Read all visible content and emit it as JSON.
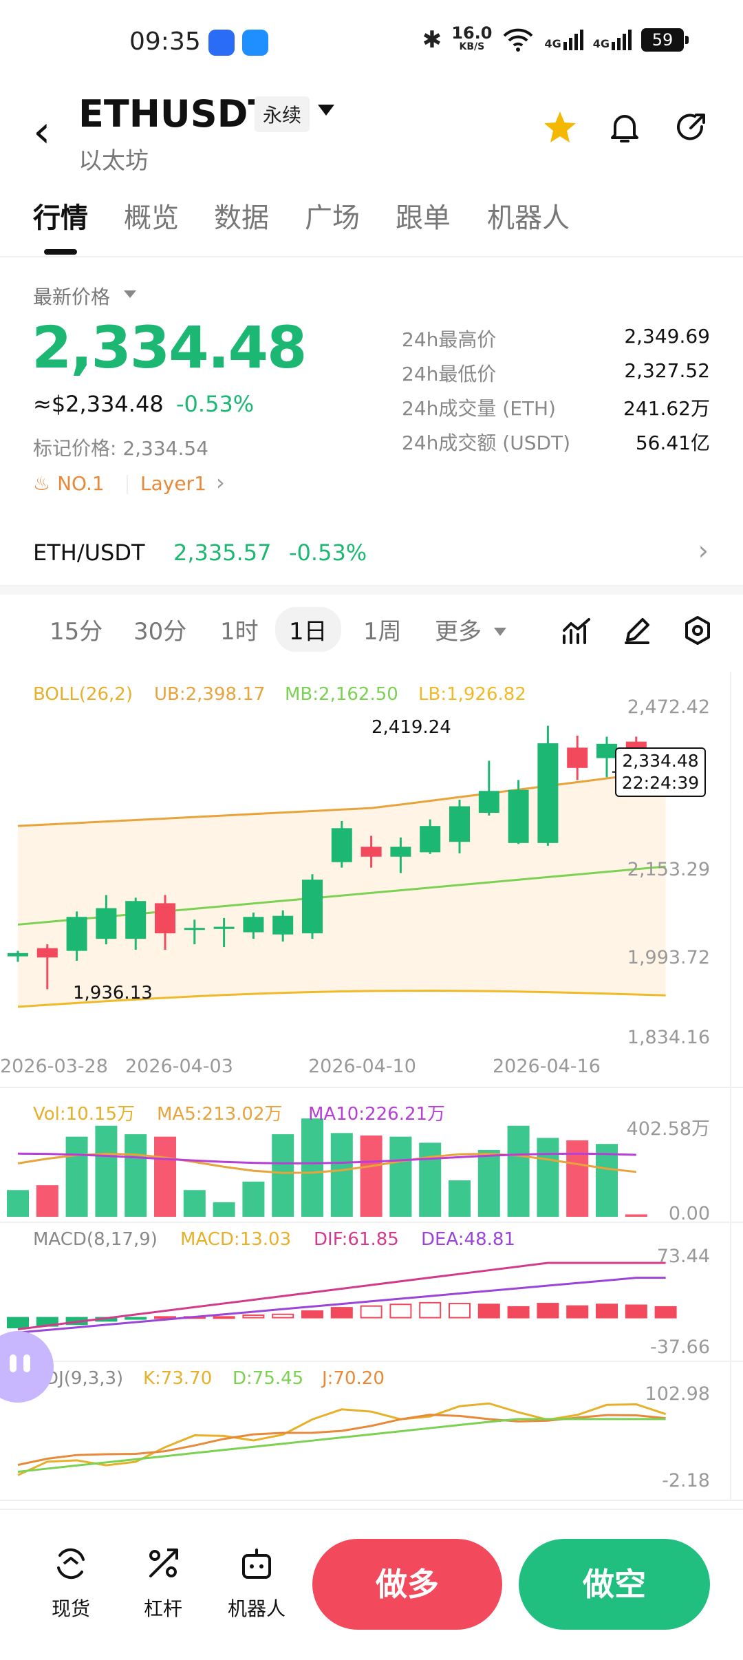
{
  "status_bar": {
    "time": "09:35",
    "net_speed_value": "16.0",
    "net_speed_unit": "KB/S",
    "signal1": "4G",
    "signal2": "4G",
    "battery": "59"
  },
  "header": {
    "symbol": "ETHUSDT",
    "contract_type": "永续",
    "name": "以太坊"
  },
  "tabs": [
    "行情",
    "概览",
    "数据",
    "广场",
    "跟单",
    "机器人"
  ],
  "price": {
    "latest_label": "最新价格",
    "last": "2,334.48",
    "usd": "≈$2,334.48",
    "change": "-0.53%",
    "mark": "标记价格: 2,334.54",
    "badge_rank": "NO.1",
    "badge_sector": "Layer1"
  },
  "stats": [
    {
      "label": "24h最高价",
      "value": "2,349.69"
    },
    {
      "label": "24h最低价",
      "value": "2,327.52"
    },
    {
      "label": "24h成交量 (ETH)",
      "value": "241.62万"
    },
    {
      "label": "24h成交额 (USDT)",
      "value": "56.41亿"
    }
  ],
  "spot_pair": {
    "name": "ETH/USDT",
    "price": "2,335.57",
    "change": "-0.53%"
  },
  "intervals": [
    "15分",
    "30分",
    "1时",
    "1日",
    "1周",
    "更多"
  ],
  "colors": {
    "up": "#1db774",
    "down": "#f2495c",
    "boll_ub": "#e8a33a",
    "boll_mb": "#7ad152",
    "boll_lb": "#f0b928",
    "ma5": "#e8a33a",
    "ma10": "#b83ed8",
    "dif": "#d33a8c",
    "dea": "#9a45d8"
  },
  "chart_data": {
    "type": "candlestick",
    "boll": {
      "label": "BOLL(26,2)",
      "ub": "UB:2,398.17",
      "mb": "MB:2,162.50",
      "lb": "LB:1,926.82"
    },
    "price_axis": [
      "2,472.42",
      "2,153.29",
      "1,993.72",
      "1,834.16"
    ],
    "price_range": [
      1834.16,
      2472.42
    ],
    "x_labels": [
      "2026-03-28",
      "2026-04-03",
      "2026-04-10",
      "2026-04-16"
    ],
    "high_marker": "2,419.24",
    "low_marker": "1,936.13",
    "current_price": "2,334.48",
    "countdown": "22:24:39",
    "candles": [
      {
        "o": 1998,
        "h": 2008,
        "l": 1988,
        "c": 2004
      },
      {
        "o": 2013,
        "h": 2020,
        "l": 1938,
        "c": 1996
      },
      {
        "o": 2008,
        "h": 2080,
        "l": 1990,
        "c": 2070
      },
      {
        "o": 2030,
        "h": 2110,
        "l": 2020,
        "c": 2086
      },
      {
        "o": 2030,
        "h": 2105,
        "l": 2010,
        "c": 2099
      },
      {
        "o": 2095,
        "h": 2110,
        "l": 2010,
        "c": 2040
      },
      {
        "o": 2050,
        "h": 2065,
        "l": 2020,
        "c": 2050
      },
      {
        "o": 2048,
        "h": 2068,
        "l": 2015,
        "c": 2052
      },
      {
        "o": 2042,
        "h": 2078,
        "l": 2030,
        "c": 2070
      },
      {
        "o": 2038,
        "h": 2082,
        "l": 2025,
        "c": 2072
      },
      {
        "o": 2040,
        "h": 2148,
        "l": 2030,
        "c": 2138
      },
      {
        "o": 2170,
        "h": 2245,
        "l": 2160,
        "c": 2232
      },
      {
        "o": 2198,
        "h": 2218,
        "l": 2160,
        "c": 2180
      },
      {
        "o": 2180,
        "h": 2215,
        "l": 2150,
        "c": 2198
      },
      {
        "o": 2188,
        "h": 2248,
        "l": 2185,
        "c": 2236
      },
      {
        "o": 2207,
        "h": 2284,
        "l": 2186,
        "c": 2272
      },
      {
        "o": 2260,
        "h": 2355,
        "l": 2255,
        "c": 2300
      },
      {
        "o": 2205,
        "h": 2320,
        "l": 2203,
        "c": 2302
      },
      {
        "o": 2205,
        "h": 2419,
        "l": 2200,
        "c": 2387
      },
      {
        "o": 2379,
        "h": 2401,
        "l": 2320,
        "c": 2342
      },
      {
        "o": 2360,
        "h": 2399,
        "l": 2325,
        "c": 2386
      },
      {
        "o": 2390,
        "h": 2399,
        "l": 2302,
        "c": 2378
      },
      {
        "o": 2337,
        "h": 2355,
        "l": 2330,
        "c": 2334
      }
    ],
    "volume": {
      "label": "Vol:10.15万",
      "ma5": "MA5:213.02万",
      "ma10": "MA10:226.21万",
      "axis": [
        "402.58万",
        "0.00"
      ],
      "max": 402.58,
      "bars": [
        110,
        130,
        330,
        375,
        340,
        330,
        110,
        60,
        145,
        340,
        405,
        345,
        335,
        330,
        305,
        150,
        275,
        375,
        325,
        315,
        300,
        10
      ]
    },
    "macd": {
      "label": "MACD(8,17,9)",
      "macd": "MACD:13.03",
      "dif": "DIF:61.85",
      "dea": "DEA:48.81",
      "axis": [
        "73.44",
        "-37.66"
      ],
      "range": [
        -37.66,
        73.44
      ],
      "hist": [
        -12,
        -10,
        -8,
        -4,
        -1,
        1,
        1,
        1,
        3,
        4,
        8,
        12,
        14,
        16,
        18,
        17,
        16,
        13,
        17,
        14,
        16,
        15,
        13
      ]
    },
    "kdj": {
      "label": "KDJ(9,3,3)",
      "k": "K:73.70",
      "d": "D:75.45",
      "j": "J:70.20",
      "axis": [
        "102.98",
        "-2.18"
      ],
      "range": [
        -2.18,
        102.98
      ]
    }
  },
  "bottom_nav": [
    {
      "label": "现货",
      "icon": "spot-icon"
    },
    {
      "label": "杠杆",
      "icon": "leverage-icon"
    },
    {
      "label": "机器人",
      "icon": "robot-icon"
    }
  ],
  "actions": {
    "long": "做多",
    "short": "做空"
  }
}
